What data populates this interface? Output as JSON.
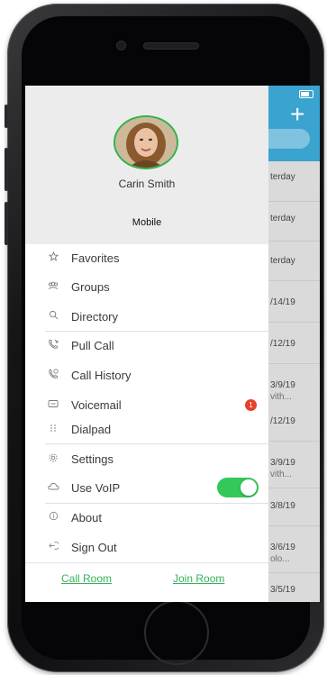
{
  "colors": {
    "accent": "#34c759",
    "link": "#35b25a",
    "badge": "#e8402a",
    "header": "#3aa3cf"
  },
  "profile": {
    "name": "Carin Smith",
    "device": "Mobile"
  },
  "menu": [
    {
      "label": "Favorites",
      "icon": "star-icon"
    },
    {
      "label": "Groups",
      "icon": "groups-icon"
    },
    {
      "label": "Directory",
      "icon": "search-icon"
    },
    {
      "label": "Pull Call",
      "icon": "pull-call-icon"
    },
    {
      "label": "Call History",
      "icon": "call-history-icon"
    },
    {
      "label": "Voicemail",
      "icon": "voicemail-icon",
      "badge": "1"
    },
    {
      "label": "Dialpad",
      "icon": "dialpad-icon"
    },
    {
      "label": "Settings",
      "icon": "gear-icon"
    },
    {
      "label": "Use VoIP",
      "icon": "cloud-icon",
      "toggle_on": true
    },
    {
      "label": "About",
      "icon": "info-icon"
    },
    {
      "label": "Sign Out",
      "icon": "sign-out-icon"
    }
  ],
  "footer": {
    "call_room": "Call Room",
    "join_room": "Join Room"
  },
  "background_list": [
    {
      "date": "terday"
    },
    {
      "date": "terday"
    },
    {
      "date": "terday"
    },
    {
      "date": "/14/19"
    },
    {
      "date": "/12/19"
    },
    {
      "date": "3/9/19",
      "sub": "vith..."
    },
    {
      "date": "/12/19"
    },
    {
      "date": "3/9/19",
      "sub": "vith..."
    },
    {
      "date": "3/8/19"
    },
    {
      "date": "3/6/19",
      "sub": "olo..."
    },
    {
      "date": "3/5/19"
    }
  ]
}
